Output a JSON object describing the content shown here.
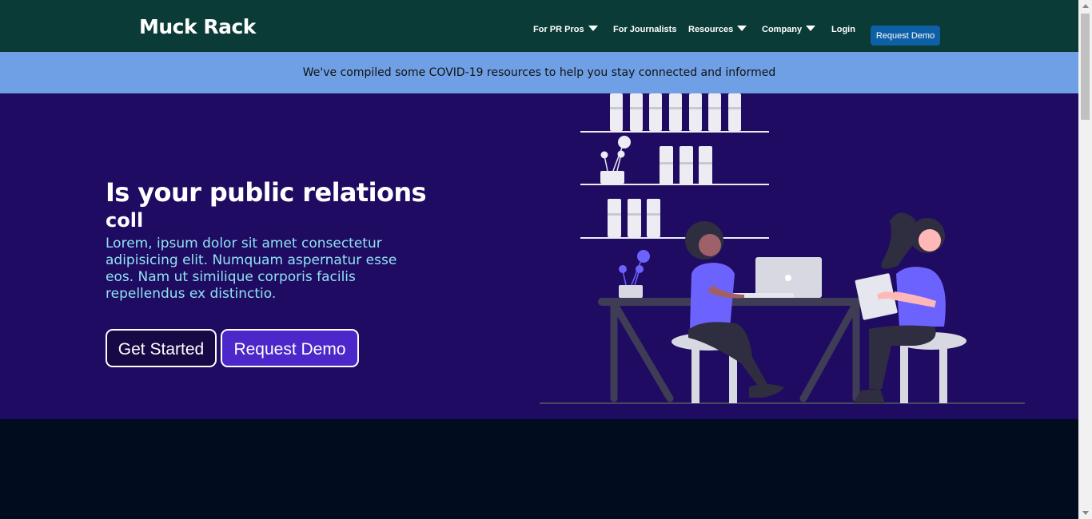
{
  "brand": "Muck Rack",
  "nav": {
    "items": [
      {
        "label": "For PR Pros",
        "dropdown": true
      },
      {
        "label": "For Journalists",
        "dropdown": false
      },
      {
        "label": "Resources",
        "dropdown": true
      },
      {
        "label": "Company",
        "dropdown": true
      },
      {
        "label": "Login",
        "dropdown": false
      }
    ],
    "cta": "Request Demo"
  },
  "announcement": "We've compiled some COVID-19 resources to help you stay connected and informed",
  "hero": {
    "headline": "Is your public relations",
    "rotating_word": "coll",
    "lead": "Lorem, ipsum dolor sit amet consectetur adipisicing elit. Numquam aspernatur esse eos. Nam ut similique corporis facilis repellendus ex distinctio.",
    "primary_button": "Get Started",
    "secondary_button": "Request Demo"
  },
  "colors": {
    "navbar": "#0b3b36",
    "announcement": "#6fa0e6",
    "hero": "#200b63",
    "accent": "#4c27c9",
    "lead_text": "#8fe3f0",
    "page_bottom": "#010c1f"
  },
  "icons": [
    "chevron-down-icon",
    "office-illustration"
  ]
}
